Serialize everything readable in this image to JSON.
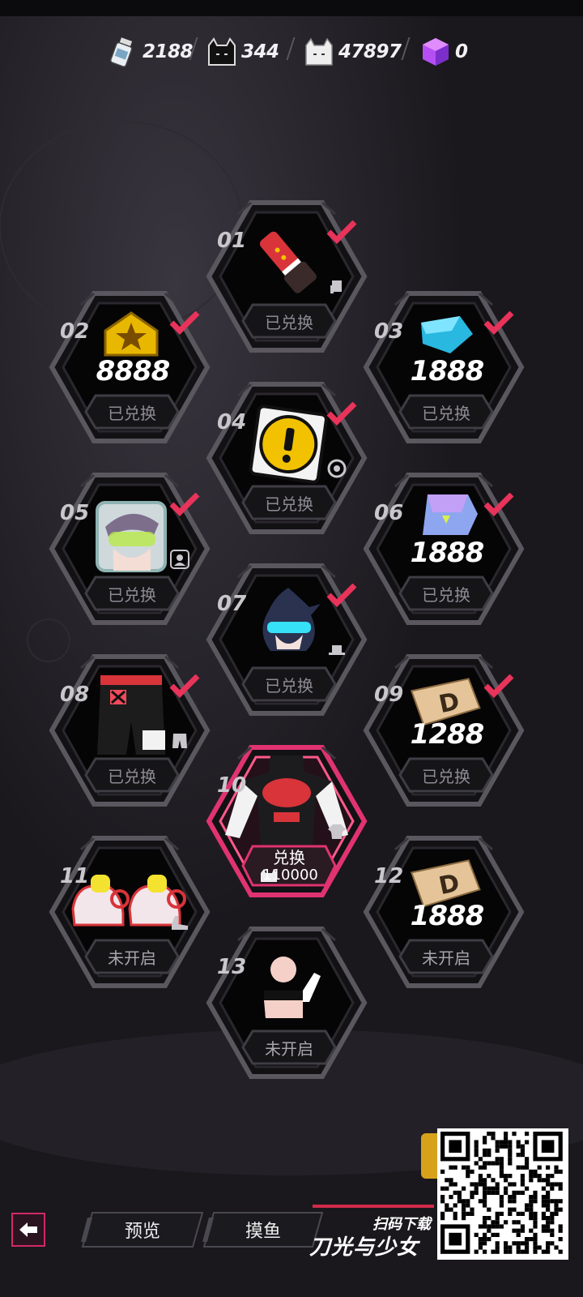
{
  "currencies": [
    {
      "name": "bottle",
      "value": "2188",
      "icon": "milk-bottle-icon"
    },
    {
      "name": "black-cat",
      "value": "344",
      "icon": "black-cat-box-icon"
    },
    {
      "name": "white-cat",
      "value": "47897",
      "icon": "white-cat-box-icon"
    },
    {
      "name": "crystal",
      "value": "0",
      "icon": "purple-cube-icon"
    }
  ],
  "nodes": [
    {
      "num": "01",
      "status": "已兑换",
      "claimed": true,
      "item": "red-glove-icon",
      "type": "glove-type-icon"
    },
    {
      "num": "02",
      "status": "已兑换",
      "claimed": true,
      "item": "gold-badge-icon",
      "amount": "8888"
    },
    {
      "num": "03",
      "status": "已兑换",
      "claimed": true,
      "item": "blue-gem-icon",
      "amount": "1888"
    },
    {
      "num": "04",
      "status": "已兑换",
      "claimed": true,
      "item": "exclamation-frame-icon",
      "type": "circle-type-icon"
    },
    {
      "num": "05",
      "status": "已兑换",
      "claimed": true,
      "item": "avatar-portrait-icon",
      "type": "portrait-type-icon"
    },
    {
      "num": "06",
      "status": "已兑换",
      "claimed": true,
      "item": "purple-ticket-icon",
      "amount": "1888"
    },
    {
      "num": "07",
      "status": "已兑换",
      "claimed": true,
      "item": "visor-hair-icon",
      "type": "hat-type-icon"
    },
    {
      "num": "08",
      "status": "已兑换",
      "claimed": true,
      "item": "red-shorts-icon",
      "type": "pants-type-icon"
    },
    {
      "num": "09",
      "status": "已兑换",
      "claimed": true,
      "item": "d-tag-icon",
      "amount": "1288"
    },
    {
      "num": "10",
      "status": "兑换",
      "claimed": false,
      "active": true,
      "item": "red-top-icon",
      "type": "shirt-type-icon",
      "cost": "110000"
    },
    {
      "num": "11",
      "status": "未开启",
      "claimed": false,
      "item": "sneakers-icon",
      "type": "shoe-type-icon"
    },
    {
      "num": "12",
      "status": "未开启",
      "claimed": false,
      "item": "d-tag-icon",
      "amount": "1888"
    },
    {
      "num": "13",
      "status": "未开启",
      "claimed": false,
      "item": "pose-icon"
    }
  ],
  "bottom": {
    "preview": "预览",
    "fish": "摸鱼",
    "scan": "扫码下载",
    "brand": "刀光与少女"
  },
  "colors": {
    "accent": "#e0336f",
    "claimed_check": "#e8335a",
    "gold": "#f2c200",
    "cyan": "#3ec8e8",
    "purple": "#a86cf0"
  }
}
